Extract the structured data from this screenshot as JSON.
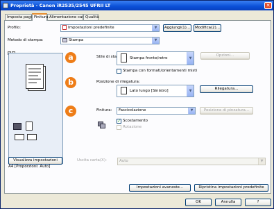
{
  "window": {
    "title": "Proprietà - Canon iR2535/2545 UFRII LT",
    "close_label": "✕"
  },
  "tabs": [
    "Imposta pagina",
    "Finitura",
    "Alimentazione carta",
    "Qualità"
  ],
  "profile": {
    "label": "Profilo:",
    "value": "Impostazioni predefinite",
    "add_button": "Aggiungi(1)...",
    "edit_button": "Modifica(2)..."
  },
  "output_method": {
    "label": "Metodo di stampa:",
    "value": "Stampa"
  },
  "preview": {
    "caption": "A4 [Proporzioni: Auto]"
  },
  "callouts": [
    "a",
    "b",
    "c"
  ],
  "print_style": {
    "label": "Stile di stampa:",
    "value": "Stampa fronte/retro",
    "options_button": "Opzioni...",
    "mixed_label": "Stampa con formati/orientamenti misti",
    "mixed_checked": false
  },
  "binding": {
    "label": "Posizione di rilegatura:",
    "value": "Lato lungo [Sinistro]",
    "button": "Rilegatura..."
  },
  "finishing": {
    "label": "Finitura:",
    "value": "Fascicolazione",
    "staple_button": "Posizione di pinzatura...",
    "offset_label": "Scostamento",
    "offset_checked": true,
    "rotate_label": "Rotazione",
    "rotate_checked": false
  },
  "view_settings_button": "Visualizza impostazioni",
  "output_tray": {
    "label": "Uscita carta(X):",
    "value": "Auto"
  },
  "advanced_button": "Impostazioni avanzate...",
  "restore_button": "Ripristina impostazioni predefinite",
  "footer": {
    "ok": "OK",
    "cancel": "Annulla",
    "help": "?"
  }
}
